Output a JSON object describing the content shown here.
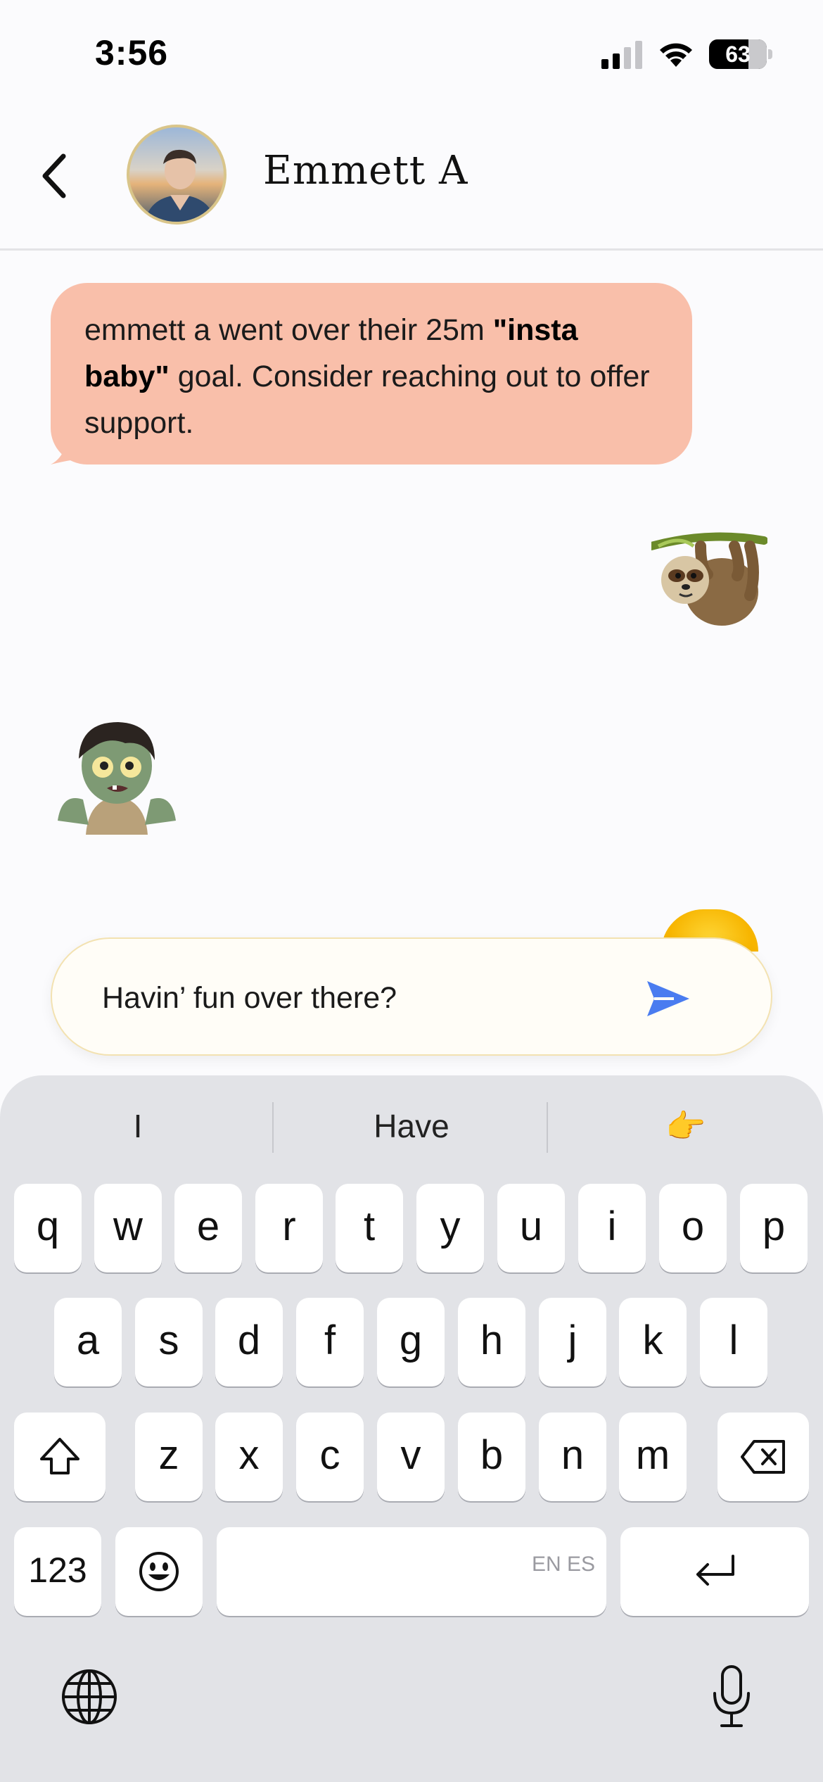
{
  "status_bar": {
    "time": "3:56",
    "battery": "63"
  },
  "header": {
    "contact_name": "Emmett A"
  },
  "nudge": {
    "text_before": "emmett a went over their 25m ",
    "goal": "\"insta baby\"",
    "text_after": " goal. Consider reaching out to offer support."
  },
  "messages": [
    {
      "from": "me",
      "emoji": "sloth"
    },
    {
      "from": "them",
      "emoji": "zombie"
    }
  ],
  "composer": {
    "value": "Havin’ fun over there?"
  },
  "keyboard": {
    "suggestions": [
      "I",
      "Have",
      "👉"
    ],
    "row1": [
      "q",
      "w",
      "e",
      "r",
      "t",
      "y",
      "u",
      "i",
      "o",
      "p"
    ],
    "row2": [
      "a",
      "s",
      "d",
      "f",
      "g",
      "h",
      "j",
      "k",
      "l"
    ],
    "row3": [
      "z",
      "x",
      "c",
      "v",
      "b",
      "n",
      "m"
    ],
    "numbers_key": "123",
    "space_lang": "EN ES"
  },
  "colors": {
    "nudge_bg": "#f9bfaa",
    "send_blue": "#4a7cf0",
    "keyboard_bg": "#e2e3e7"
  }
}
